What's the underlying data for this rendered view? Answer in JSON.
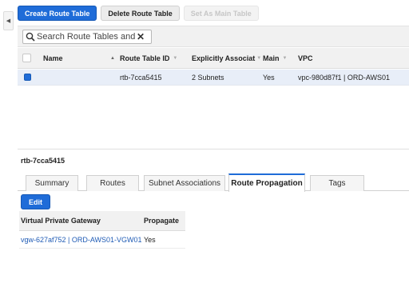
{
  "toolbar": {
    "create_label": "Create Route Table",
    "delete_label": "Delete Route Table",
    "set_main_label": "Set As Main Table"
  },
  "search": {
    "placeholder": "Search Route Tables and thei",
    "icon": "search-icon",
    "clear_glyph": "✕"
  },
  "table": {
    "columns": [
      "Name",
      "Route Table ID",
      "Explicitly Associat",
      "Main",
      "VPC"
    ],
    "rows": [
      {
        "selected": true,
        "name": "",
        "route_table_id": "rtb-7cca5415",
        "explicitly_associated": "2 Subnets",
        "main": "Yes",
        "vpc": "vpc-980d87f1 | ORD-AWS01"
      }
    ]
  },
  "detail": {
    "title": "rtb-7cca5415",
    "tabs": [
      "Summary",
      "Routes",
      "Subnet Associations",
      "Route Propagation",
      "Tags"
    ],
    "active_tab": "Route Propagation",
    "edit_label": "Edit",
    "propagation_table": {
      "columns": [
        "Virtual Private Gateway",
        "Propagate"
      ],
      "rows": [
        {
          "gateway": "vgw-627af752 | ORD-AWS01-VGW01",
          "propagate": "Yes"
        }
      ]
    }
  },
  "colors": {
    "primary": "#1f6cd8",
    "selected_row": "#e8eef8",
    "link": "#1f5bb5"
  }
}
